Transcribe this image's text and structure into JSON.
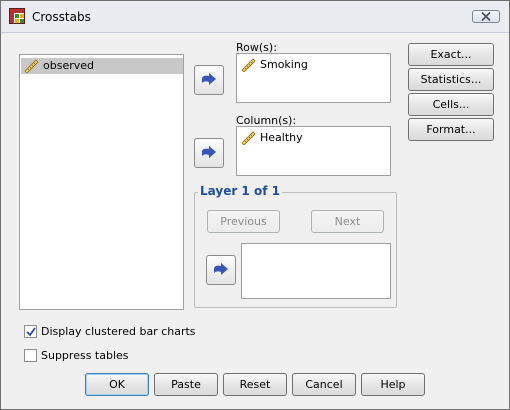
{
  "window": {
    "title": "Crosstabs"
  },
  "variables": {
    "items": [
      {
        "label": "observed",
        "selected": true
      }
    ]
  },
  "rows": {
    "label": "Row(s):",
    "items": [
      "Smoking"
    ]
  },
  "columns": {
    "label": "Column(s):",
    "items": [
      "Healthy"
    ]
  },
  "layer": {
    "label": "Layer 1 of 1",
    "previous": "Previous",
    "next": "Next"
  },
  "side_buttons": {
    "exact": "Exact...",
    "statistics": "Statistics...",
    "cells": "Cells...",
    "format": "Format..."
  },
  "options": {
    "clustered_bar": "Display clustered bar charts",
    "clustered_bar_checked": true,
    "suppress_tables": "Suppress tables",
    "suppress_tables_checked": false
  },
  "footer": {
    "ok": "OK",
    "paste": "Paste",
    "reset": "Reset",
    "cancel": "Cancel",
    "help": "Help"
  },
  "icons": {
    "app": "crosstabs-app-icon",
    "variable": "ruler-scale-icon",
    "move": "move-right-arrow-icon",
    "close": "close-x-icon"
  },
  "colors": {
    "accent_arrow": "#3b55b4",
    "layer_label": "#1e4e9c",
    "checkmark": "#2a4b9b"
  }
}
